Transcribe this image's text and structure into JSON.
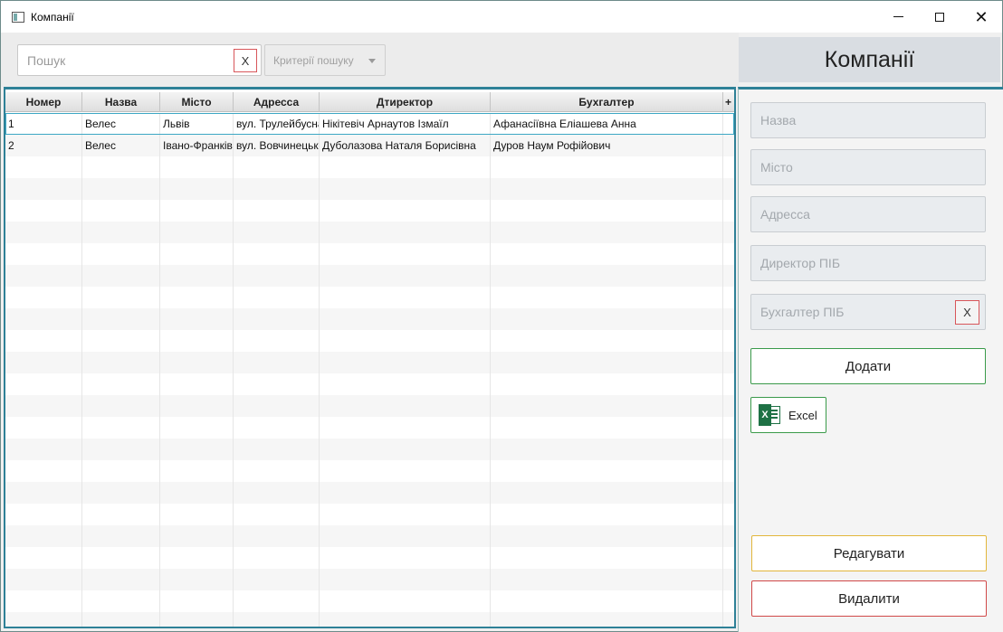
{
  "window": {
    "title": "Компанії",
    "minimize_icon": "minimize-icon",
    "maximize_icon": "maximize-icon",
    "close_icon": "close-icon"
  },
  "toolbar": {
    "search_placeholder": "Пошук",
    "search_value": "",
    "search_clear_label": "X",
    "criteria_label": "Критерії пошуку"
  },
  "header": {
    "title": "Компанії"
  },
  "table": {
    "columns": [
      "Номер",
      "Назва",
      "Місто",
      "Адресса",
      "Дтиректор",
      "Бухгалтер"
    ],
    "add_column_label": "+",
    "rows": [
      [
        "1",
        "Велес",
        "Львів",
        "вул. Трулейбусна",
        "Нікітевіч Арнаутов Ізмаїл",
        "Афанасіївна Еліашева Анна"
      ],
      [
        "2",
        "Велес",
        "Івано-Франківськ",
        "вул. Вовчинецька",
        "Дуболазова Наталя Борисівна",
        "Дуров Наум Рофійович"
      ]
    ],
    "selected_row": 0
  },
  "form": {
    "name_placeholder": "Назва",
    "city_placeholder": "Місто",
    "address_placeholder": "Адресса",
    "director_placeholder": "Директор ПІБ",
    "accountant_placeholder": "Бухгалтер ПІБ",
    "accountant_clear_label": "X",
    "add_label": "Додати",
    "excel_label": "Excel",
    "excel_badge": "X",
    "edit_label": "Редагувати",
    "delete_label": "Видалити"
  },
  "colors": {
    "accent_border": "#2e8197",
    "add_border": "#3a9a4a",
    "edit_border": "#e2b63b",
    "delete_border": "#d04848"
  }
}
